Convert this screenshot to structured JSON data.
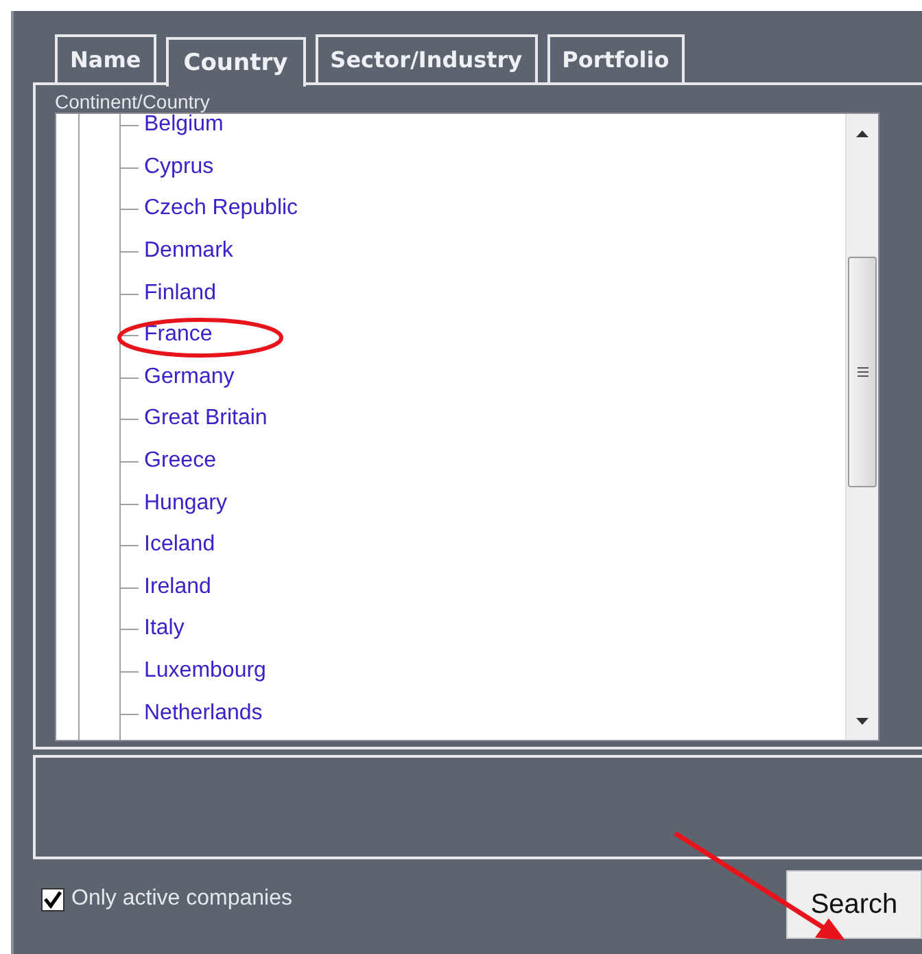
{
  "tabs": [
    {
      "label": "Name",
      "selected": false
    },
    {
      "label": "Country",
      "selected": true
    },
    {
      "label": "Sector/Industry",
      "selected": false
    },
    {
      "label": "Portfolio",
      "selected": false
    }
  ],
  "group_label": "Continent/Country",
  "tree_items": [
    {
      "label": "Belgium",
      "circled": false
    },
    {
      "label": "Cyprus",
      "circled": false
    },
    {
      "label": "Czech Republic",
      "circled": false
    },
    {
      "label": "Denmark",
      "circled": false
    },
    {
      "label": "Finland",
      "circled": false
    },
    {
      "label": "France",
      "circled": true
    },
    {
      "label": "Germany",
      "circled": false
    },
    {
      "label": "Great Britain",
      "circled": false
    },
    {
      "label": "Greece",
      "circled": false
    },
    {
      "label": "Hungary",
      "circled": false
    },
    {
      "label": "Iceland",
      "circled": false
    },
    {
      "label": "Ireland",
      "circled": false
    },
    {
      "label": "Italy",
      "circled": false
    },
    {
      "label": "Luxembourg",
      "circled": false
    },
    {
      "label": "Netherlands",
      "circled": false
    }
  ],
  "only_active": {
    "label": "Only active companies",
    "checked": true
  },
  "search_button": {
    "label": "Search",
    "arrow": true
  }
}
